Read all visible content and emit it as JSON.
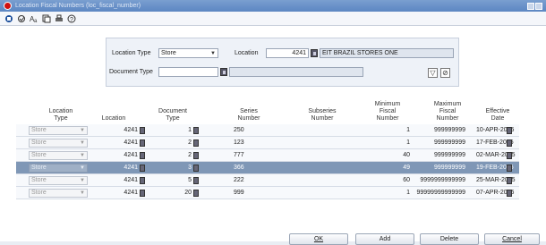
{
  "window": {
    "title": "Location Fiscal Numbers (loc_fiscal_number)"
  },
  "filters": {
    "location_type_label": "Location Type",
    "location_type_value": "Store",
    "location_label": "Location",
    "location_value": "4241",
    "location_name": "EIT BRAZIL STORES ONE",
    "document_type_label": "Document Type",
    "document_type_value": ""
  },
  "table": {
    "headers": {
      "location_type": "Location\nType",
      "location": "Location",
      "document_type": "Document\nType",
      "series_number": "Series\nNumber",
      "subseries_number": "Subseries\nNumber",
      "min_fiscal": "Minimum\nFiscal\nNumber",
      "max_fiscal": "Maximum\nFiscal\nNumber",
      "effective_date": "Effective\nDate"
    },
    "rows": [
      {
        "loc_type": "Store",
        "location": "4241",
        "doc_type": "1",
        "series": "250",
        "subseries": "",
        "min": "1",
        "max": "999999999",
        "date": "10-APR-2015"
      },
      {
        "loc_type": "Store",
        "location": "4241",
        "doc_type": "2",
        "series": "123",
        "subseries": "",
        "min": "1",
        "max": "999999999",
        "date": "17-FEB-2015"
      },
      {
        "loc_type": "Store",
        "location": "4241",
        "doc_type": "2",
        "series": "777",
        "subseries": "",
        "min": "40",
        "max": "999999999",
        "date": "02-MAR-2015"
      },
      {
        "loc_type": "Store",
        "location": "4241",
        "doc_type": "3",
        "series": "366",
        "subseries": "",
        "min": "49",
        "max": "999999999",
        "date": "19-FEB-2015"
      },
      {
        "loc_type": "Store",
        "location": "4241",
        "doc_type": "5",
        "series": "222",
        "subseries": "",
        "min": "60",
        "max": "9999999999999",
        "date": "25-MAR-2015"
      },
      {
        "loc_type": "Store",
        "location": "4241",
        "doc_type": "20",
        "series": "999",
        "subseries": "",
        "min": "1",
        "max": "99999999999999",
        "date": "07-APR-2015"
      }
    ],
    "selected_row": 3
  },
  "buttons": {
    "ok": "OK",
    "add": "Add",
    "delete": "Delete",
    "cancel": "Cancel"
  },
  "icons": [
    "app-icon",
    "save-icon",
    "spellcheck-icon",
    "copy-icon",
    "print-icon",
    "help-icon",
    "filter-icon",
    "clear-filter-icon",
    "lov-icon"
  ]
}
